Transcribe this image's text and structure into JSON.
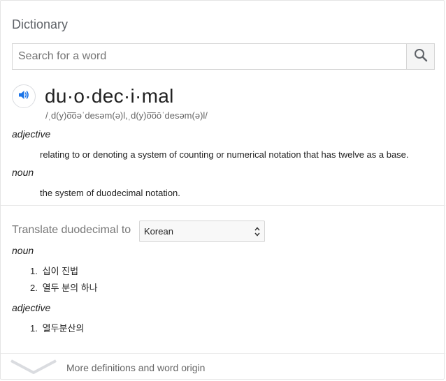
{
  "header": {
    "title": "Dictionary"
  },
  "search": {
    "placeholder": "Search for a word",
    "value": ""
  },
  "entry": {
    "headword": "du·o·dec·i·mal",
    "phonetic": "/ˌd(y)o͞oəˈdesəm(ə)l,ˌd(y)o͞oōˈdesəm(ə)l/",
    "senses": [
      {
        "pos": "adjective",
        "definition": "relating to or denoting a system of counting or numerical notation that has twelve as a base."
      },
      {
        "pos": "noun",
        "definition": "the system of duodecimal notation."
      }
    ]
  },
  "translate": {
    "label": "Translate duodecimal to",
    "language": "Korean",
    "groups": [
      {
        "pos": "noun",
        "items": [
          {
            "num": "1.",
            "text": "십이 진법"
          },
          {
            "num": "2.",
            "text": "열두 분의 하나"
          }
        ]
      },
      {
        "pos": "adjective",
        "items": [
          {
            "num": "1.",
            "text": "열두분산의"
          }
        ]
      }
    ]
  },
  "footer": {
    "more_label": "More definitions and word origin"
  },
  "icons": {
    "search": "search-icon",
    "speaker": "speaker-icon",
    "select": "select-arrows-icon",
    "more": "chevron-down-icon"
  },
  "colors": {
    "accent": "#1a73e8",
    "muted": "#777777"
  }
}
